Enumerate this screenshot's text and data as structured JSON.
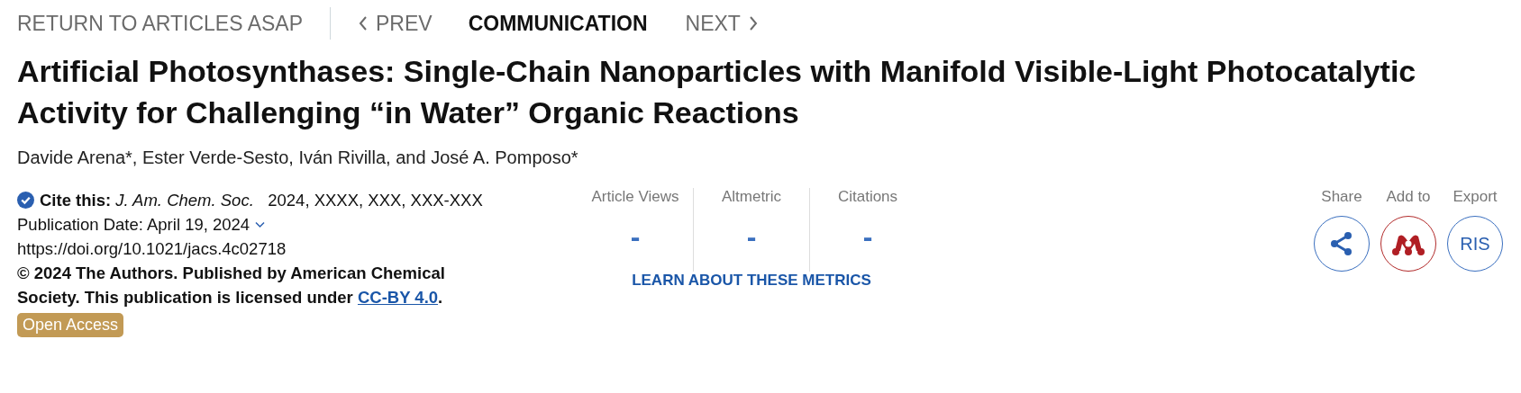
{
  "nav": {
    "return_link": "RETURN TO ARTICLES ASAP",
    "prev": "PREV",
    "section": "COMMUNICATION",
    "next": "NEXT"
  },
  "title": "Artificial Photosynthases: Single-Chain Nanoparticles with Manifold Visible-Light Photocatalytic Activity for Challenging “in Water” Organic Reactions",
  "authors": "Davide Arena*, Ester Verde-Sesto, Iván Rivilla, and José A. Pomposo*",
  "citation": {
    "label": "Cite this:",
    "journal": "J. Am. Chem. Soc.",
    "details": "2024, XXXX, XXX, XXX-XXX",
    "publication_date": "Publication Date: April 19, 2024",
    "doi": "https://doi.org/10.1021/jacs.4c02718",
    "license": "© 2024 The Authors. Published by American Chemical Society. This publication is licensed under",
    "license_link": "CC-BY 4.0",
    "license_end": ".",
    "badge": "Open Access"
  },
  "metrics": [
    {
      "label": "Article Views",
      "value": "-"
    },
    {
      "label": "Altmetric",
      "value": "-"
    },
    {
      "label": "Citations",
      "value": "-"
    }
  ],
  "metrics_link": "LEARN ABOUT THESE METRICS",
  "actions": [
    {
      "label": "Share",
      "kind": "share"
    },
    {
      "label": "Add to",
      "kind": "mendeley"
    },
    {
      "label": "Export",
      "kind": "ris",
      "text": "RIS"
    }
  ]
}
